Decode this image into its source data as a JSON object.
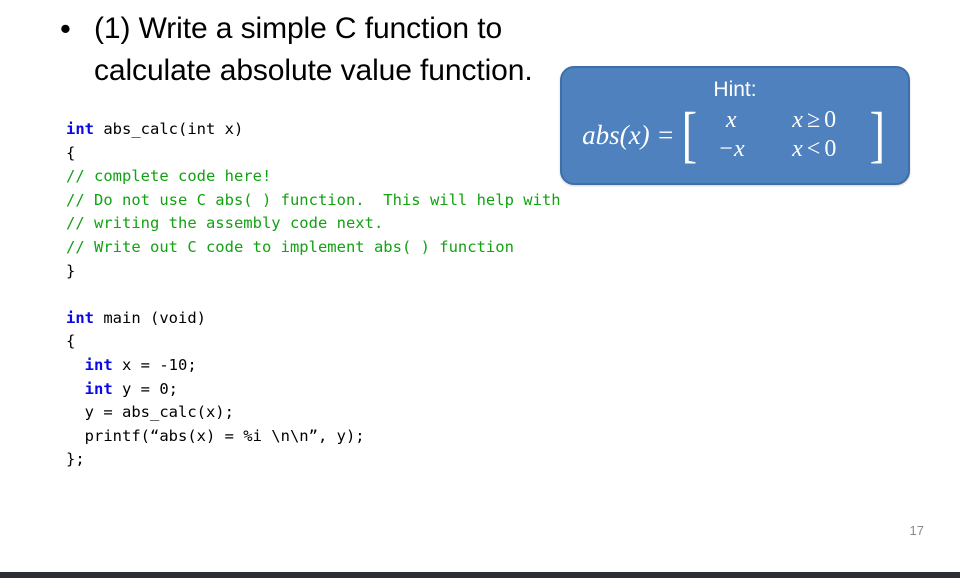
{
  "slide": {
    "bullet_marker": "•",
    "bullet_text": "(1) Write a simple C function to calculate absolute value function.",
    "slide_number": "17"
  },
  "hint": {
    "label": "Hint:",
    "formula_lhs": "abs(x) =",
    "bracket_open": "[",
    "bracket_close": "]",
    "rows": [
      {
        "value": "x",
        "condition_var": "x",
        "condition_op": "≥",
        "condition_rhs": "0"
      },
      {
        "value": "−x",
        "condition_var": "x",
        "condition_op": "<",
        "condition_rhs": "0"
      }
    ],
    "box_color": "#4E81BD",
    "border_color": "#3F6FA8",
    "text_color": "#ffffff"
  },
  "code": {
    "keyword_color": "#0A0AE6",
    "comment_color": "#12A212",
    "lines": [
      {
        "kind": "mixed",
        "keyword": "int",
        "rest": " abs_calc(int x)"
      },
      {
        "kind": "plain",
        "text": "{"
      },
      {
        "kind": "comment",
        "text": "// complete code here!"
      },
      {
        "kind": "comment",
        "text": "// Do not use C abs( ) function.  This will help with"
      },
      {
        "kind": "comment",
        "text": "// writing the assembly code next."
      },
      {
        "kind": "comment",
        "text": "// Write out C code to implement abs( ) function"
      },
      {
        "kind": "plain",
        "text": "}"
      },
      {
        "kind": "blank",
        "text": ""
      },
      {
        "kind": "mixed",
        "keyword": "int",
        "rest": " main (void)"
      },
      {
        "kind": "plain",
        "text": "{"
      },
      {
        "kind": "mixed-indent",
        "indent": "  ",
        "keyword": "int",
        "rest": " x = -10;"
      },
      {
        "kind": "mixed-indent",
        "indent": "  ",
        "keyword": "int",
        "rest": " y = 0;"
      },
      {
        "kind": "plain",
        "text": "  y = abs_calc(x);"
      },
      {
        "kind": "plain",
        "text": "  printf(“abs(x) = %i \\n\\n”, y);"
      },
      {
        "kind": "plain",
        "text": "};"
      }
    ]
  }
}
